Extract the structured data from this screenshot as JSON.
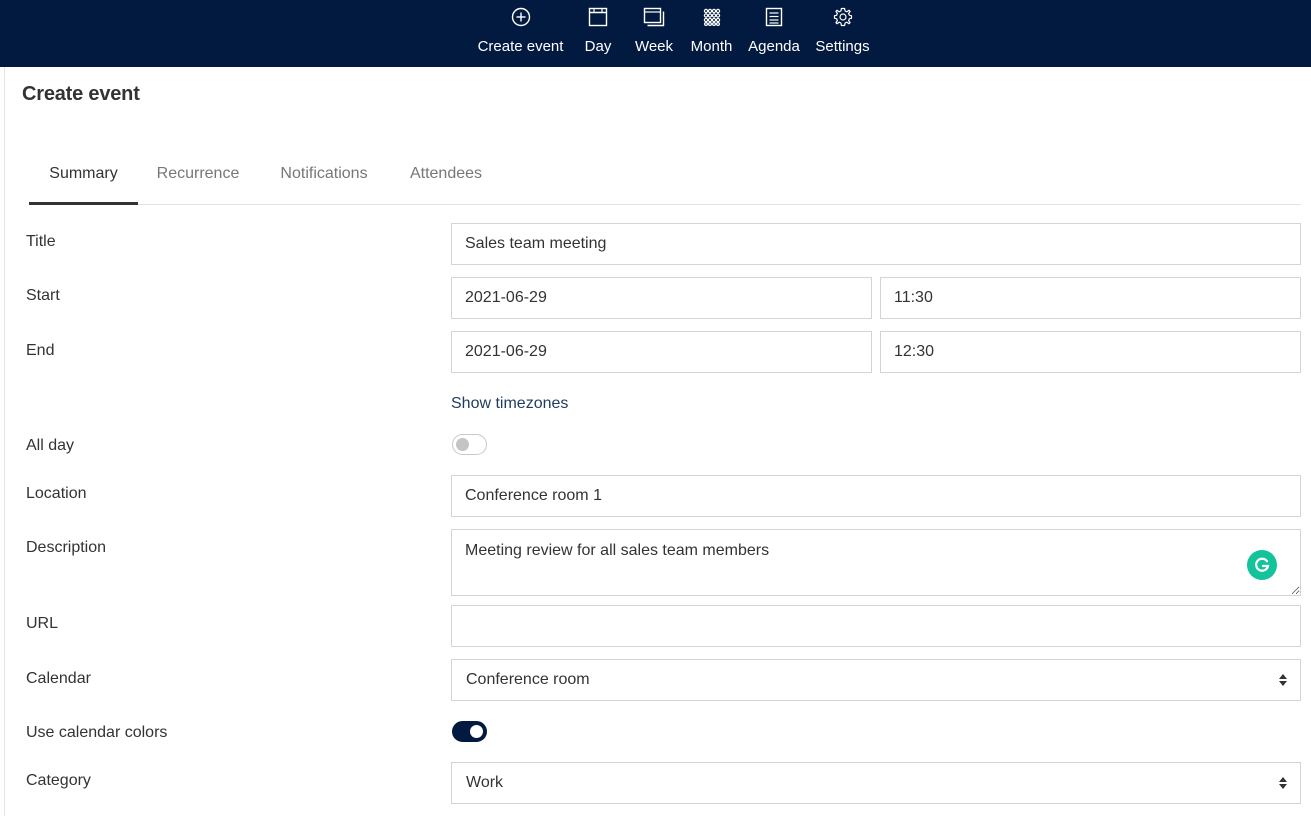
{
  "nav": {
    "items": [
      {
        "label": "Create event",
        "icon": "plus-circle-icon"
      },
      {
        "label": "Day",
        "icon": "day-view-icon"
      },
      {
        "label": "Week",
        "icon": "week-view-icon"
      },
      {
        "label": "Month",
        "icon": "month-grid-icon"
      },
      {
        "label": "Agenda",
        "icon": "agenda-list-icon"
      },
      {
        "label": "Settings",
        "icon": "gear-icon"
      }
    ]
  },
  "page": {
    "title": "Create event"
  },
  "tabs": [
    {
      "label": "Summary",
      "active": true
    },
    {
      "label": "Recurrence",
      "active": false
    },
    {
      "label": "Notifications",
      "active": false
    },
    {
      "label": "Attendees",
      "active": false
    }
  ],
  "form": {
    "title": {
      "label": "Title",
      "value": "Sales team meeting"
    },
    "start": {
      "label": "Start",
      "date": "2021-06-29",
      "time": "11:30"
    },
    "end": {
      "label": "End",
      "date": "2021-06-29",
      "time": "12:30"
    },
    "show_timezones": "Show timezones",
    "all_day": {
      "label": "All day",
      "checked": false
    },
    "location": {
      "label": "Location",
      "value": "Conference room 1"
    },
    "description": {
      "label": "Description",
      "value": "Meeting review for all sales team members"
    },
    "url": {
      "label": "URL",
      "value": ""
    },
    "calendar": {
      "label": "Calendar",
      "value": "Conference room"
    },
    "use_calendar_colors": {
      "label": "Use calendar colors",
      "checked": true
    },
    "category": {
      "label": "Category",
      "value": "Work"
    }
  },
  "colors": {
    "nav_background": "#021a40",
    "toggle_on": "#021a40",
    "link": "#1e3c5f",
    "grammarly": "#15c39a"
  }
}
